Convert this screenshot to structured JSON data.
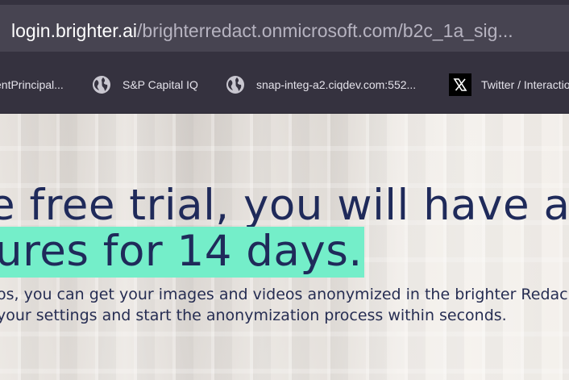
{
  "address_bar": {
    "host": "login.brighter.ai",
    "path": "/brighterredact.onmicrosoft.com/b2c_1a_sig..."
  },
  "bookmarks": [
    {
      "label": "entPrincipal...",
      "icon": "none"
    },
    {
      "label": "S&P Capital IQ",
      "icon": "globe-icon"
    },
    {
      "label": "snap-integ-a2.ciqdev.com:552...",
      "icon": "globe-icon"
    },
    {
      "label": "Twitter / Interactio",
      "icon": "x-logo-icon"
    }
  ],
  "hero": {
    "headline_line1": "e free trial, you will have acce",
    "headline_line2": "ures for 14 days.",
    "subtext_line1": "os, you can get your images and videos anonymized in the brighter Redac",
    "subtext_line2": "your settings and start the anonymization process within seconds.",
    "highlight_color": "#74eec9",
    "text_color": "#1f2a5a"
  }
}
